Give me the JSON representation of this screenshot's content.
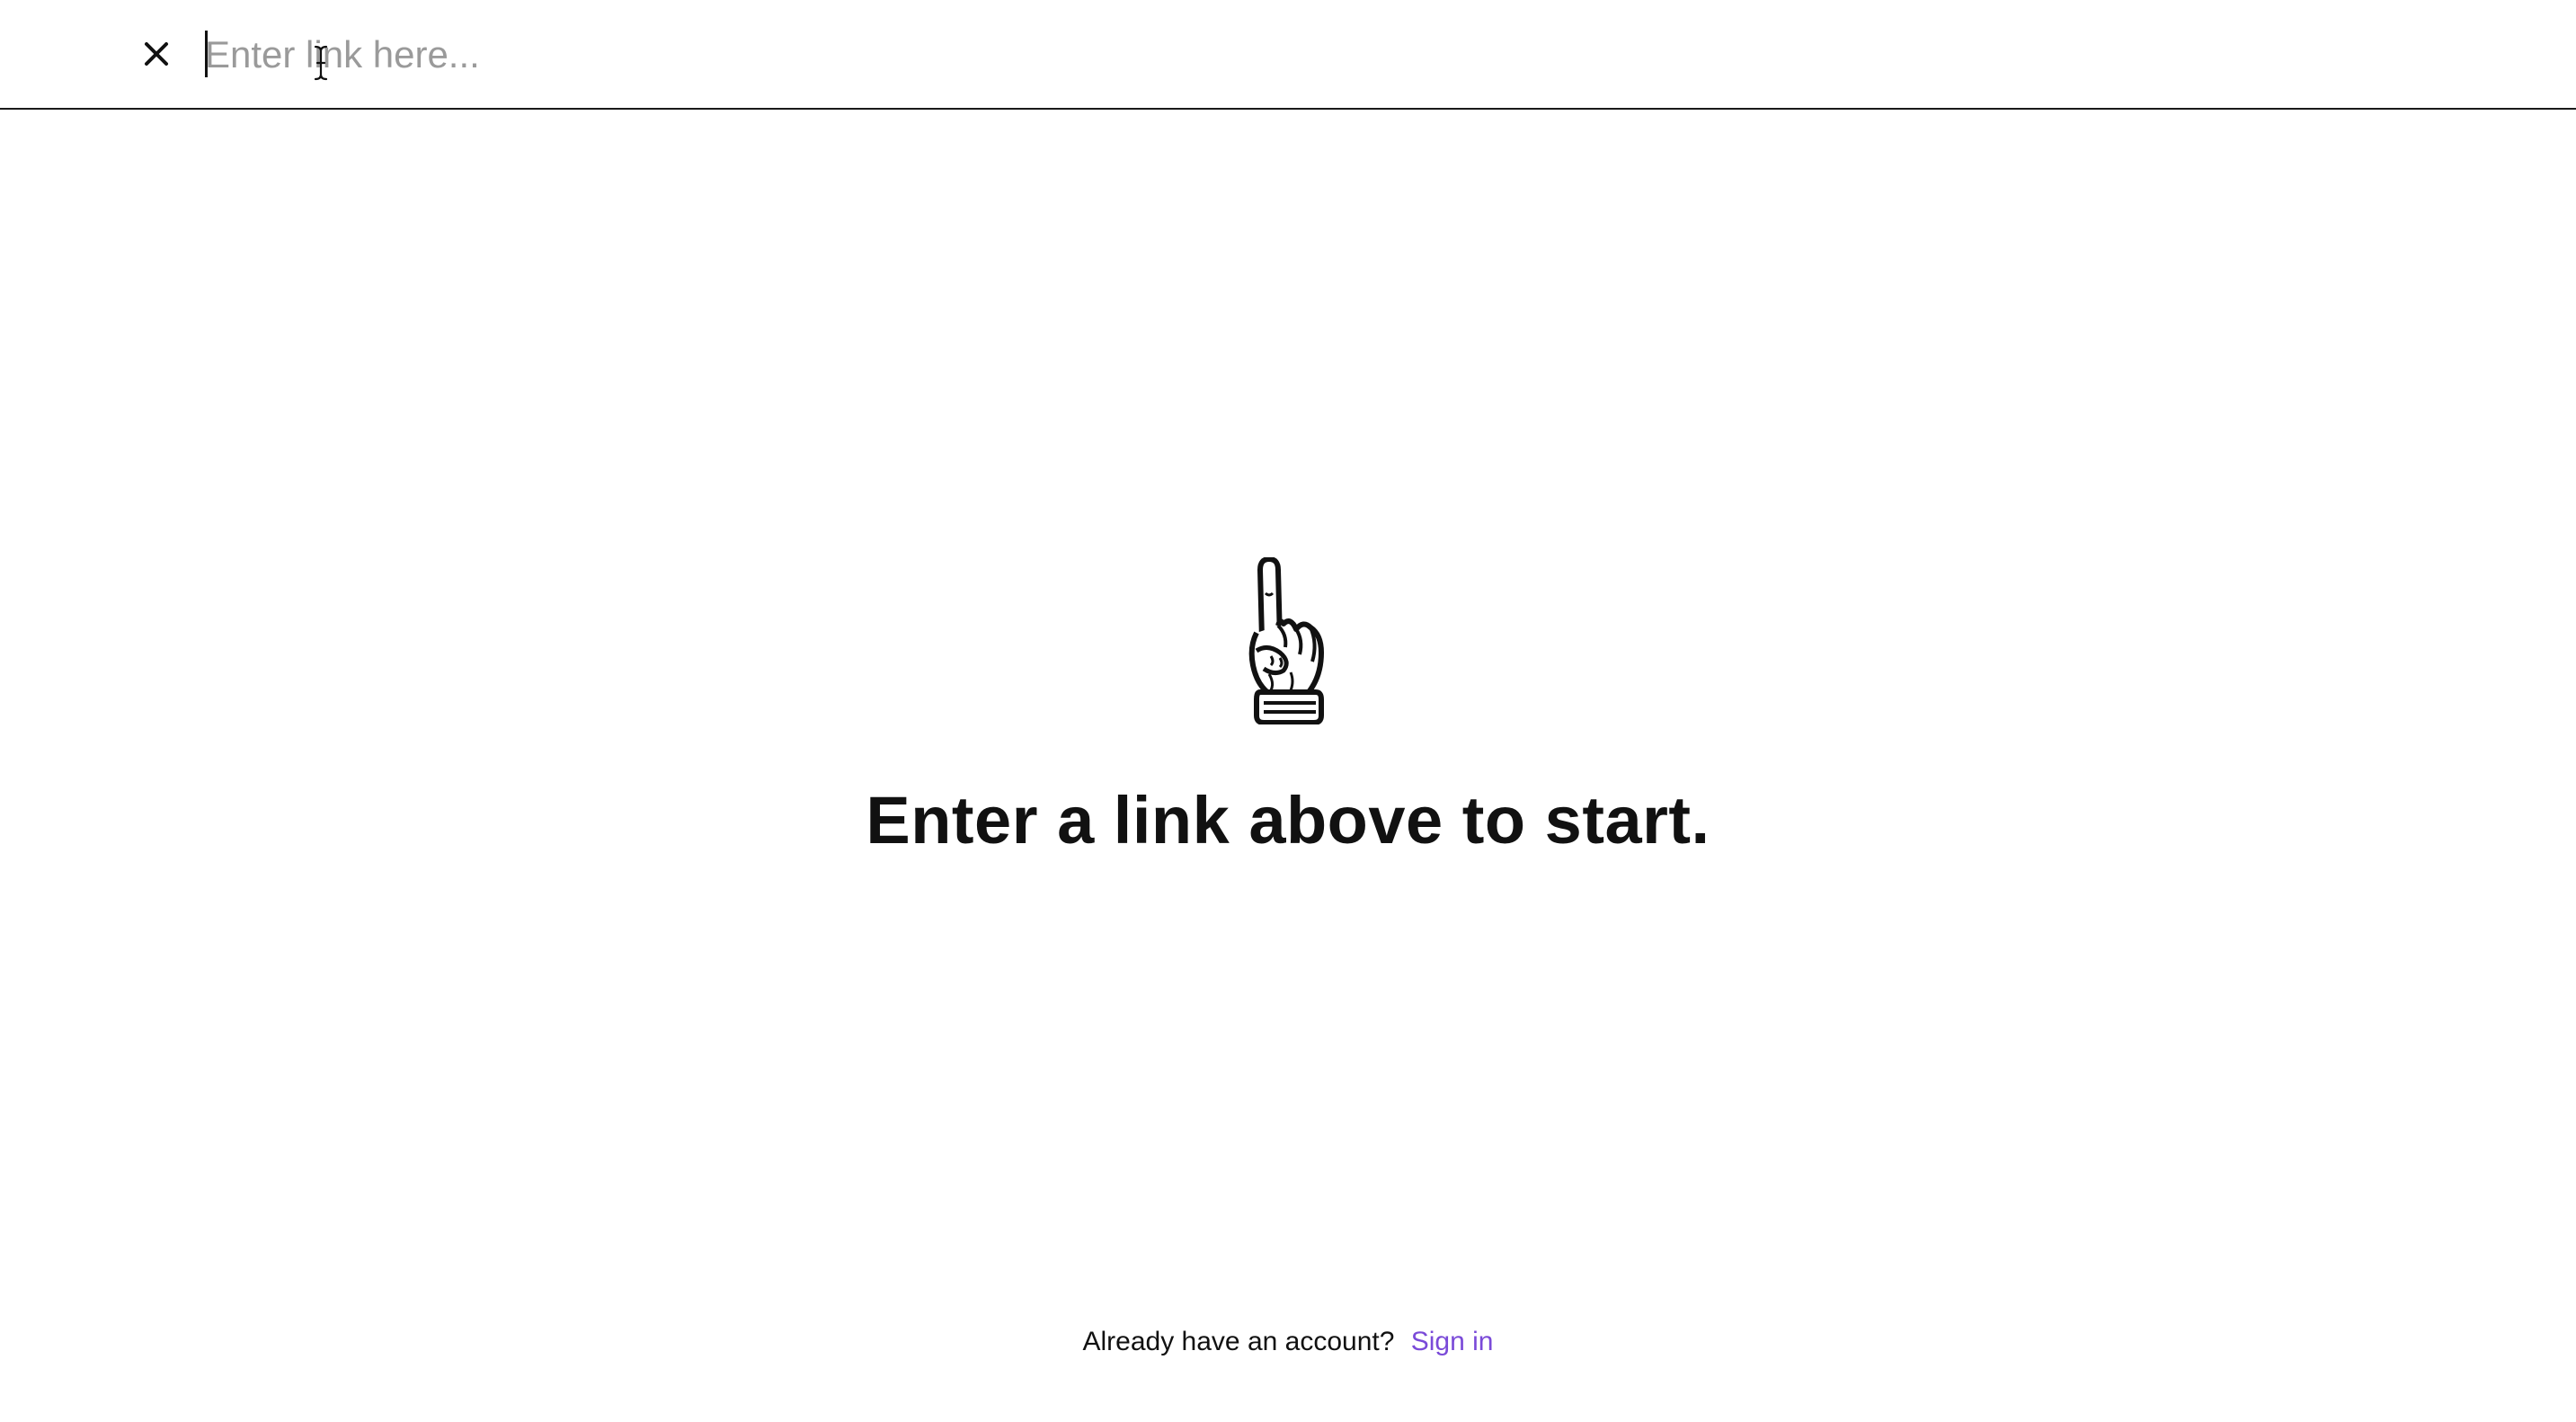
{
  "topbar": {
    "close_icon": "close-icon",
    "input": {
      "placeholder": "Enter link here...",
      "value": ""
    }
  },
  "main": {
    "illustration_icon": "pointing-hand-icon",
    "headline": "Enter a link above to start."
  },
  "footer": {
    "prompt": "Already have an account?",
    "signin_label": "Sign in"
  },
  "colors": {
    "link": "#7a4ad8",
    "placeholder": "#9a9a9a",
    "border": "#1a1a1a"
  }
}
